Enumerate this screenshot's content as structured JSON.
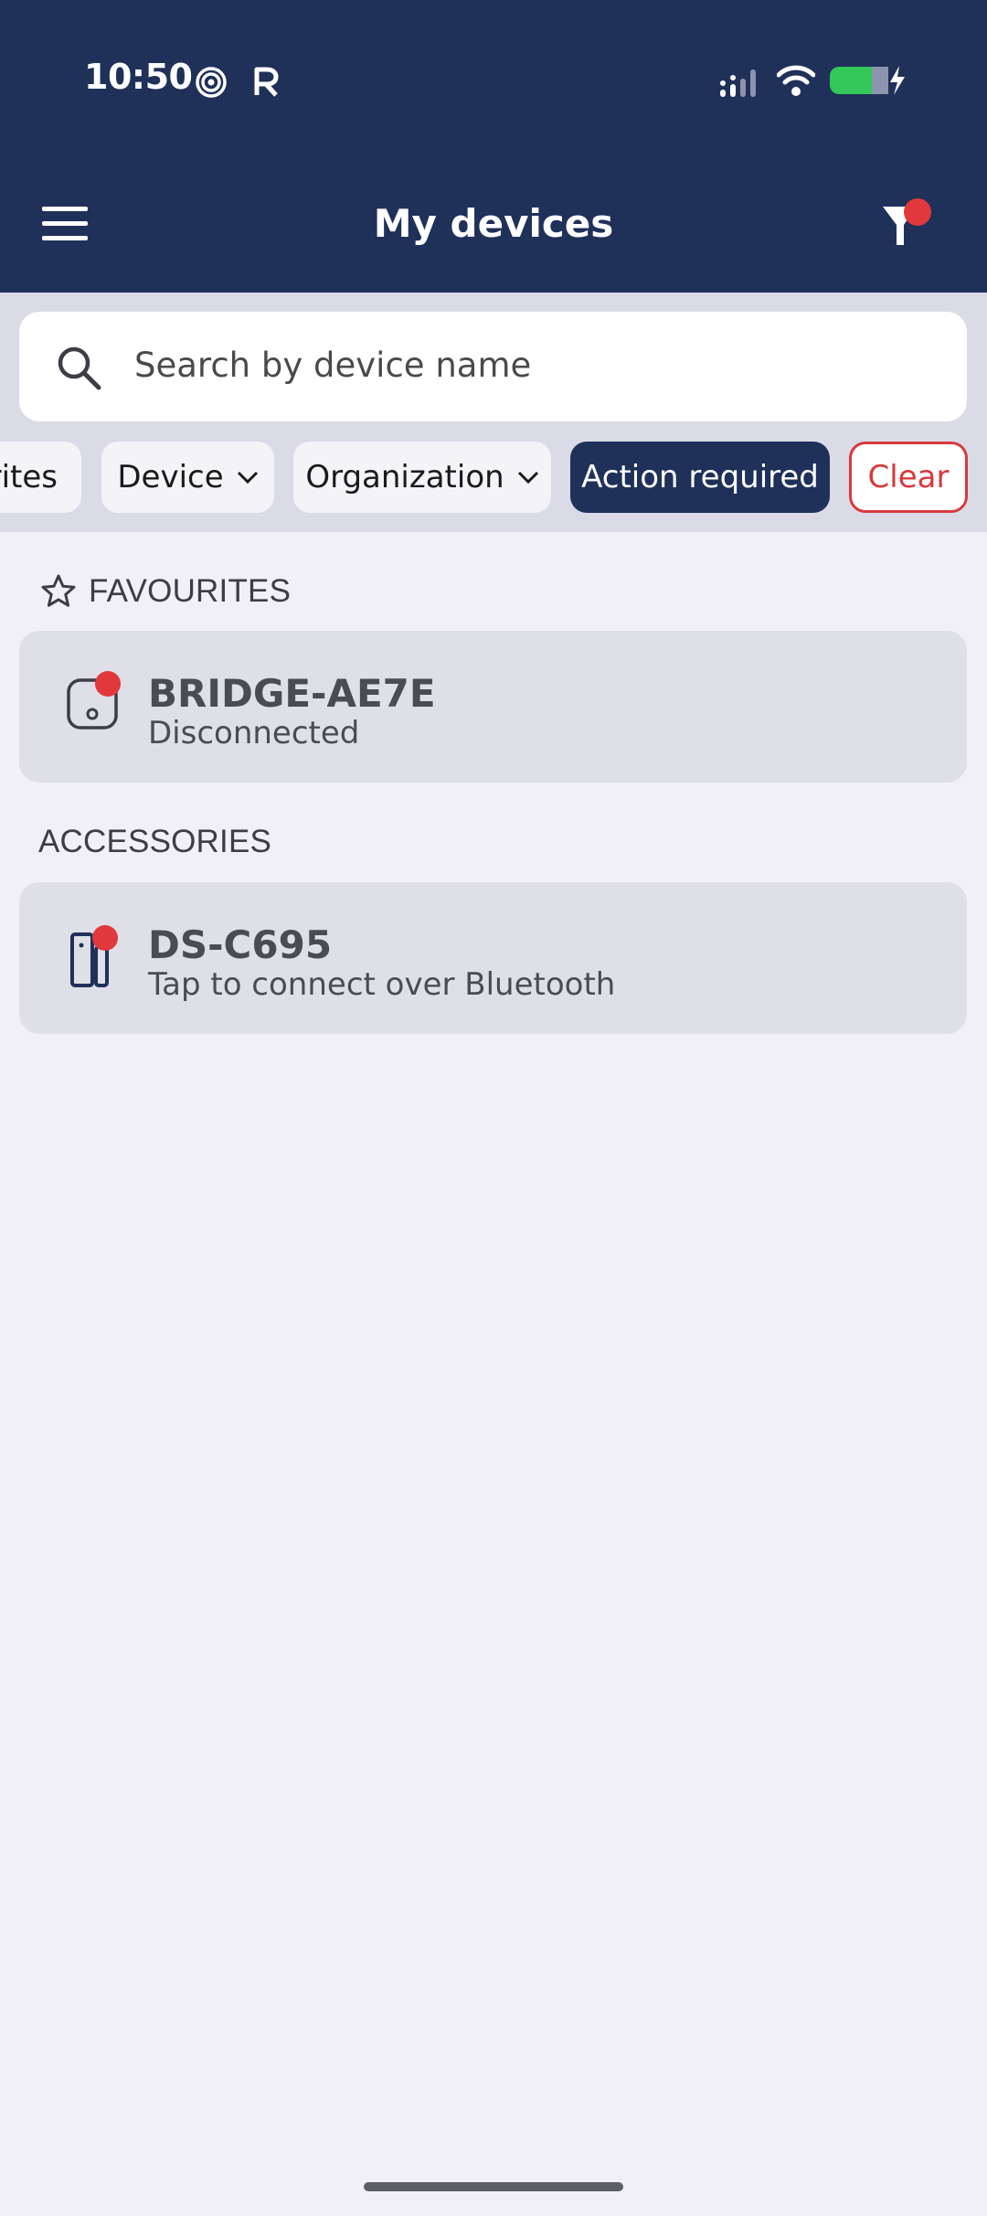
{
  "status_bar": {
    "time": "10:50",
    "icons": [
      "hotspot-spiral-icon",
      "r-app-icon",
      "cellular-signal-icon",
      "wifi-icon",
      "battery-charging-icon"
    ]
  },
  "header": {
    "title": "My devices",
    "menu_icon": "hamburger-menu-icon",
    "filter_icon": "filter-icon"
  },
  "search": {
    "placeholder": "Search by device name"
  },
  "filters": {
    "chips": [
      {
        "label": "rites",
        "has_dropdown": false
      },
      {
        "label": "Device",
        "has_dropdown": true
      },
      {
        "label": "Organization",
        "has_dropdown": true
      },
      {
        "label": "Action required",
        "has_dropdown": false
      },
      {
        "label": "Clear",
        "has_dropdown": false
      }
    ]
  },
  "favourites": {
    "heading": "FAVOURITES",
    "items": [
      {
        "name": "BRIDGE-AE7E",
        "status": "Disconnected",
        "icon": "bridge-device-icon"
      }
    ]
  },
  "accessories": {
    "heading": "ACCESSORIES",
    "items": [
      {
        "name": "DS-C695",
        "status": "Tap to connect over Bluetooth",
        "icon": "door-sensor-icon"
      }
    ]
  },
  "colors": {
    "header_bg": "#1f3059",
    "toolbar_bg": "#dadbe6",
    "page_bg": "#f0f0f6",
    "card_bg": "#dfdfe8",
    "alert_red": "#e0383b",
    "battery_green": "#34c759"
  }
}
